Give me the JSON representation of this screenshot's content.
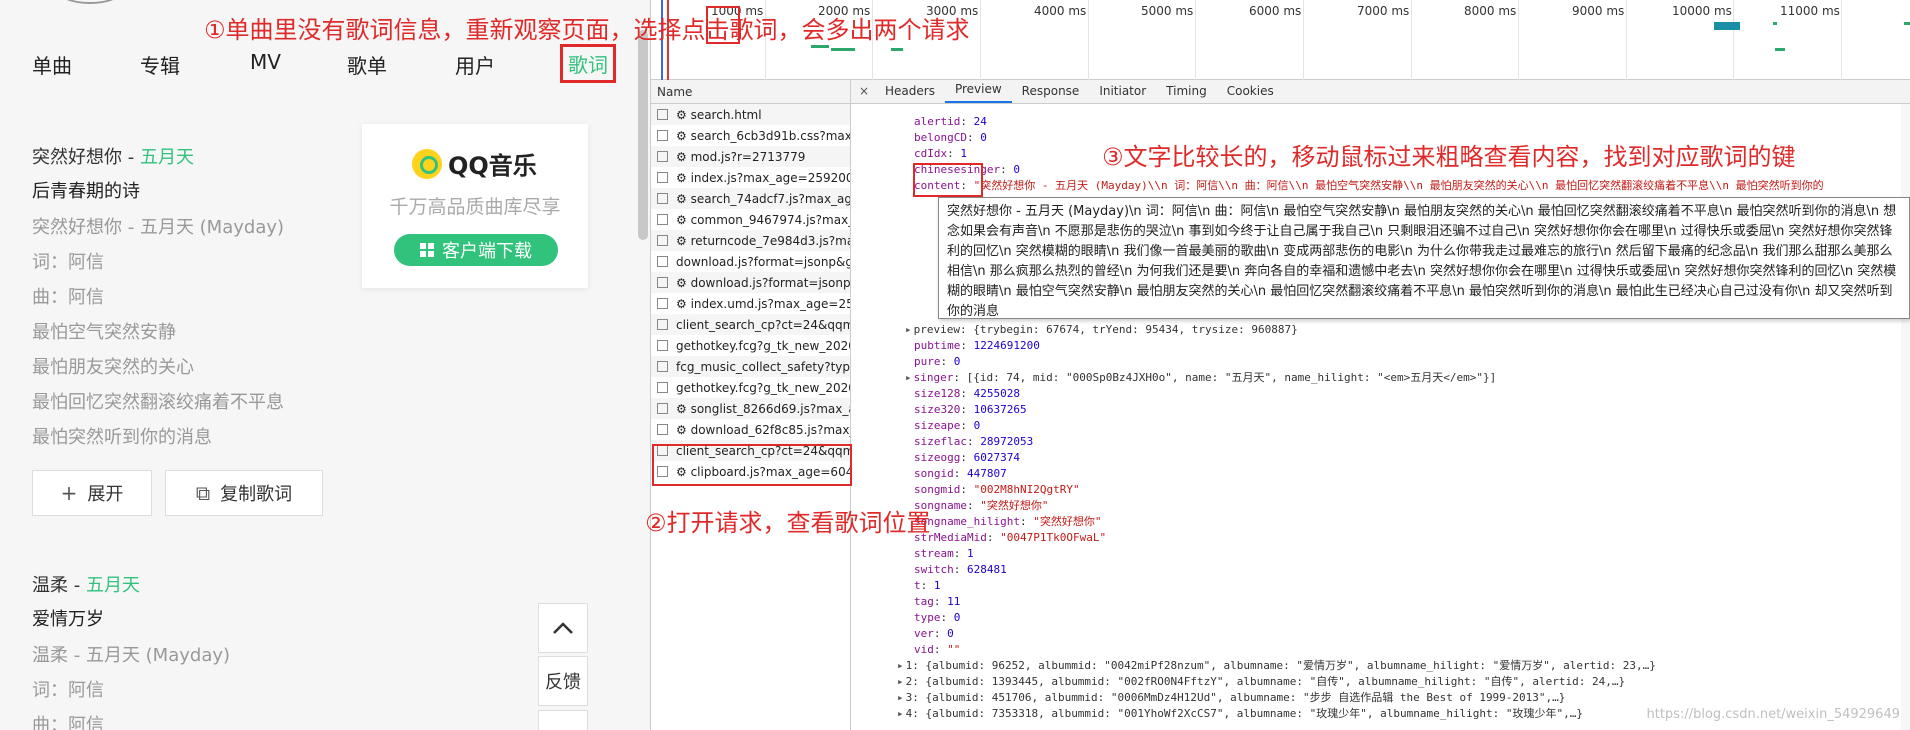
{
  "left": {
    "tabs": [
      "单曲",
      "专辑",
      "MV",
      "歌单",
      "用户",
      "歌词"
    ],
    "songs": [
      {
        "title": "突然好想你 - ",
        "artist": "五月天",
        "album": "后青春期的诗",
        "lines": [
          "突然好想你 - 五月天 (Mayday)",
          "词：阿信",
          "曲：阿信",
          "最怕空气突然安静",
          "最怕朋友突然的关心",
          "最怕回忆突然翻滚绞痛着不平息",
          "最怕突然听到你的消息"
        ]
      },
      {
        "title": "温柔 - ",
        "artist": "五月天",
        "album": "爱情万岁",
        "lines": [
          "温柔 - 五月天 (Mayday)",
          "词：阿信",
          "曲：阿信"
        ]
      }
    ],
    "expand_label": "展开",
    "copy_label": "复制歌词",
    "promo": {
      "logo_text": "QQ音乐",
      "slogan": "千万高品质曲库尽享",
      "download": "客户端下载"
    },
    "feedback": "反馈"
  },
  "annotations": {
    "a1": "①单曲里没有歌词信息，重新观察页面，选择点击歌词，会多出两个请求",
    "a2": "②打开请求，查看歌词位置",
    "a3": "③文字比较长的，移动鼠标过来粗略查看内容，找到对应歌词的键"
  },
  "devtools": {
    "ticks": [
      "1000 ms",
      "2000 ms",
      "3000 ms",
      "4000 ms",
      "5000 ms",
      "6000 ms",
      "7000 ms",
      "8000 ms",
      "9000 ms",
      "10000 ms",
      "11000 ms"
    ],
    "name_header": "Name",
    "requests": [
      "⚙ search.html",
      "⚙ search_6cb3d91b.css?max_...",
      "⚙ mod.js?r=2713779",
      "⚙ index.js?max_age=2592000",
      "⚙ search_74adcf7.js?max_age...",
      "⚙ common_9467974.js?max_a...",
      "⚙ returncode_7e984d3.js?max...",
      "download.js?format=jsonp&g...",
      "⚙ download.js?format=jsonp...",
      "⚙ index.umd.js?max_age=259...",
      "client_search_cp?ct=24&qqm...",
      "gethotkey.fcg?g_tk_new_2020...",
      "fcg_music_collect_safety?type...",
      "gethotkey.fcg?g_tk_new_2020...",
      "⚙ songlist_8266d69.js?max_a...",
      "⚙ download_62f8c85.js?max_...",
      "client_search_cp?ct=24&qqm...",
      "⚙ clipboard.js?max_age=6048..."
    ],
    "panel_tabs": [
      "Headers",
      "Preview",
      "Response",
      "Initiator",
      "Timing",
      "Cookies"
    ],
    "close": "×",
    "fields_top": [
      {
        "k": "alertid",
        "v": "24",
        "t": "n"
      },
      {
        "k": "belongCD",
        "v": "0",
        "t": "n"
      },
      {
        "k": "cdIdx",
        "v": "1",
        "t": "n"
      },
      {
        "k": "chinesesinger",
        "v": "0",
        "t": "n"
      }
    ],
    "content_key": "content",
    "content_value": "\"突然好想你 - 五月天 (Mayday)\\\\n 词：阿信\\\\n 曲：阿信\\\\n 最怕空气突然安静\\\\n 最怕朋友突然的关心\\\\n 最怕回忆突然翻滚绞痛着不平息\\\\n 最怕突然听到你的",
    "tooltip": "突然好想你 - 五月天 (Mayday)\\n 词：阿信\\n 曲：阿信\\n 最怕空气突然安静\\n 最怕朋友突然的关心\\n 最怕回忆突然翻滚绞痛着不平息\\n 最怕突然听到你的消息\\n 想念如果会有声音\\n 不愿那是悲伤的哭泣\\n 事到如今终于让自己属于我自己\\n 只剩眼泪还骗不过自己\\n 突然好想你你会在哪里\\n 过得快乐或委屈\\n 突然好想你突然锋利的回忆\\n 突然模糊的眼睛\\n 我们像一首最美丽的歌曲\\n 变成两部悲伤的电影\\n 为什么你带我走过最难忘的旅行\\n 然后留下最痛的纪念品\\n 我们那么甜那么美那么相信\\n 那么疯那么热烈的曾经\\n 为何我们还是要\\n 奔向各自的幸福和遗憾中老去\\n 突然好想你你会在哪里\\n 过得快乐或委屈\\n 突然好想你突然锋利的回忆\\n 突然模糊的眼睛\\n 最怕空气突然安静\\n 最怕朋友突然的关心\\n 最怕回忆突然翻滚绞痛着不平息\\n 最怕突然听到你的消息\\n 最怕此生已经决心自己过没有你\\n 却又突然听到你的消息",
    "preview_line": "preview: {trybegin: 67674, trYend: 95434, trysize: 960887}",
    "fields_bottom": [
      {
        "k": "pubtime",
        "v": "1224691200",
        "t": "n"
      },
      {
        "k": "pure",
        "v": "0",
        "t": "n"
      },
      {
        "k": "singer",
        "v": "[{id: 74, mid: \"000Sp0Bz4JXH0o\", name: \"五月天\", name_hilight: \"<em>五月天</em>\"}]",
        "t": "o",
        "tri": true
      },
      {
        "k": "size128",
        "v": "4255028",
        "t": "n"
      },
      {
        "k": "size320",
        "v": "10637265",
        "t": "n"
      },
      {
        "k": "sizeape",
        "v": "0",
        "t": "n"
      },
      {
        "k": "sizeflac",
        "v": "28972053",
        "t": "n"
      },
      {
        "k": "sizeogg",
        "v": "6027374",
        "t": "n"
      },
      {
        "k": "songid",
        "v": "447807",
        "t": "n"
      },
      {
        "k": "songmid",
        "v": "\"002M8hNI2QgtRY\"",
        "t": "s"
      },
      {
        "k": "songname",
        "v": "\"突然好想你\"",
        "t": "s"
      },
      {
        "k": "songname_hilight",
        "v": "\"突然好想你\"",
        "t": "s"
      },
      {
        "k": "strMediaMid",
        "v": "\"0047P1Tk0OFwaL\"",
        "t": "s"
      },
      {
        "k": "stream",
        "v": "1",
        "t": "n"
      },
      {
        "k": "switch",
        "v": "628481",
        "t": "n"
      },
      {
        "k": "t",
        "v": "1",
        "t": "n"
      },
      {
        "k": "tag",
        "v": "11",
        "t": "n"
      },
      {
        "k": "type",
        "v": "0",
        "t": "n"
      },
      {
        "k": "ver",
        "v": "0",
        "t": "n"
      },
      {
        "k": "vid",
        "v": "\"\"",
        "t": "s"
      }
    ],
    "collapsed": [
      "1: {albumid: 96252, albummid: \"0042miPf28nzum\", albumname: \"爱情万岁\", albumname_hilight: \"爱情万岁\", alertid: 23,…}",
      "2: {albumid: 1393445, albummid: \"002fRO0N4FftzY\", albumname: \"自传\", albumname_hilight: \"自传\", alertid: 24,…}",
      "3: {albumid: 451706, albummid: \"0006MmDz4H12Ud\", albumname: \"步步 自选作品辑 the Best of 1999-2013\",…}",
      "4: {albumid: 7353318, albummid: \"001YhoWf2XcCS7\", albumname: \"玫瑰少年\", albumname_hilight: \"玫瑰少年\",…}"
    ],
    "watermark": "https://blog.csdn.net/weixin_54929649"
  }
}
